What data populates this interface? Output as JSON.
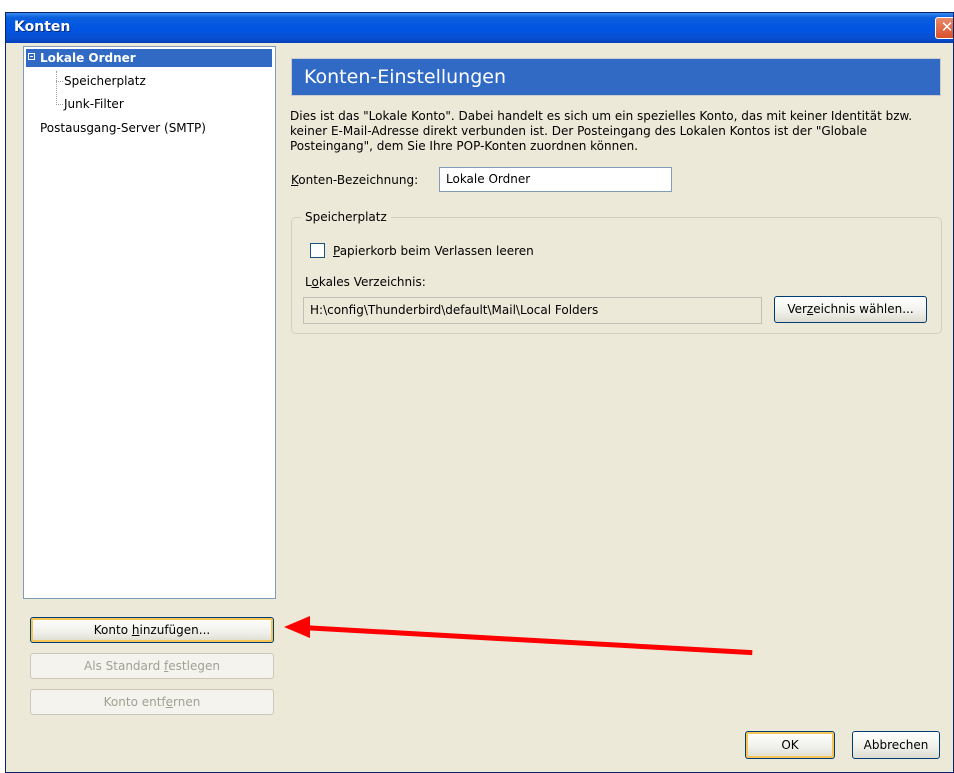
{
  "window": {
    "title": "Konten",
    "close_glyph": "✕"
  },
  "tree": {
    "root_label": "Lokale Ordner",
    "children": [
      "Speicherplatz",
      "Junk-Filter"
    ],
    "smtp_label": "Postausgang-Server (SMTP)"
  },
  "buttons": {
    "add_account": {
      "pre": "Konto ",
      "mn": "h",
      "post": "inzufügen..."
    },
    "set_default": {
      "pre": "Als Standard ",
      "mn": "f",
      "post": "estlegen"
    },
    "remove_account": {
      "pre": "Konto entf",
      "mn": "e",
      "post": "rnen"
    },
    "ok": "OK",
    "cancel": "Abbrechen"
  },
  "settings": {
    "header": "Konten-Einstellungen",
    "description": "Dies ist das \"Lokale Konto\". Dabei handelt es sich um ein spezielles Konto, das mit keiner Identität bzw. keiner E-Mail-Adresse direkt verbunden ist. Der Posteingang des Lokalen Kontos ist der \"Globale Posteingang\", dem Sie Ihre POP-Konten zuordnen können.",
    "name_label": {
      "mn": "K",
      "post": "onten-Bezeichnung:"
    },
    "name_value": "Lokale Ordner",
    "storage": {
      "legend": "Speicherplatz",
      "empty_trash": {
        "mn": "P",
        "post": "apierkorb beim Verlassen leeren"
      },
      "empty_trash_checked": false,
      "dir_label": {
        "pre": "L",
        "mn": "o",
        "post": "kales Verzeichnis:"
      },
      "dir_value": "H:\\config\\Thunderbird\\default\\Mail\\Local Folders",
      "choose_dir": {
        "pre": "Ver",
        "mn": "z",
        "post": "eichnis wählen..."
      }
    }
  },
  "colors": {
    "selection": "#316ac5",
    "titlebar": "#0054e3",
    "annotation_arrow": "#ff0000"
  }
}
